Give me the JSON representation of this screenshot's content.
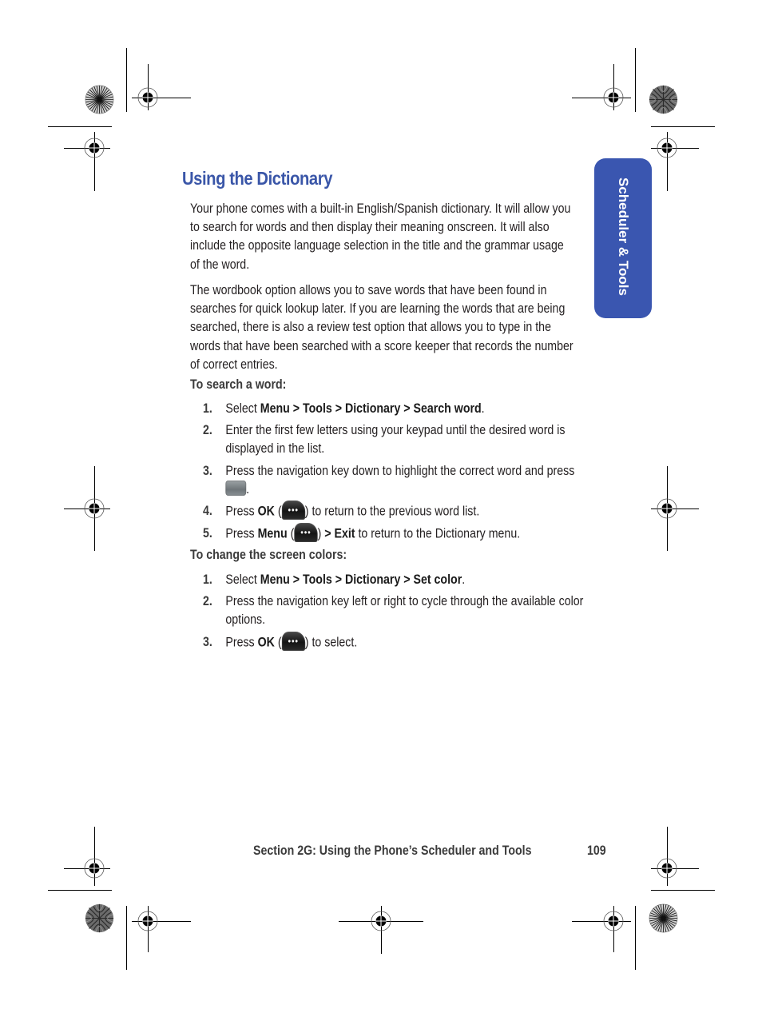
{
  "heading": "Using the Dictionary",
  "side_tab": {
    "label": "Scheduler & Tools",
    "color": "#3a56b0"
  },
  "paragraphs": [
    "Your phone comes with a built-in English/Spanish dictionary. It will allow you to search for words and then display their meaning onscreen. It will also include the opposite language selection in the title and the grammar usage of the word.",
    "The wordbook option allows you to save words that have been found in searches for quick lookup later. If you are learning the words that are being searched, there is also a review test option that allows you to type in the words that have been searched with a score keeper that records the number of correct entries."
  ],
  "search_section": {
    "heading": "To search a word:",
    "steps": [
      {
        "num": "1.",
        "pre": "Select ",
        "bold": "Menu > Tools > Dictionary > Search word",
        "post": "."
      },
      {
        "num": "2.",
        "text": "Enter the first few letters using your keypad until the desired word is displayed in the list."
      },
      {
        "num": "3.",
        "pre": "Press the navigation key down to highlight the correct word and press ",
        "icon": "center-select-key-icon",
        "post": "."
      },
      {
        "num": "4.",
        "pre": "Press ",
        "bold": "OK",
        "mid": " (",
        "icon": "ok-softkey-icon",
        "post": ") to return to the previous word list."
      },
      {
        "num": "5.",
        "pre": "Press ",
        "bold": "Menu",
        "mid": " (",
        "icon": "menu-softkey-icon",
        "post_bold": "> Exit",
        "post": " to return to the Dictionary menu."
      }
    ]
  },
  "color_section": {
    "heading": "To change the screen colors:",
    "steps": [
      {
        "num": "1.",
        "pre": "Select ",
        "bold": "Menu > Tools > Dictionary > Set color",
        "post": "."
      },
      {
        "num": "2.",
        "text": "Press the navigation key left or right to cycle through the available color options."
      },
      {
        "num": "3.",
        "pre": "Press ",
        "bold": "OK",
        "mid": " (",
        "icon": "ok-softkey-icon",
        "post": ") to select."
      }
    ]
  },
  "icons": {
    "softkey_glyph": "•••"
  },
  "footer": {
    "section": "Section 2G: Using the Phone’s Scheduler and Tools",
    "page_number": "109"
  },
  "colors": {
    "heading": "#3a56a8",
    "text": "#231f20",
    "subheading": "#3b3b3b"
  }
}
